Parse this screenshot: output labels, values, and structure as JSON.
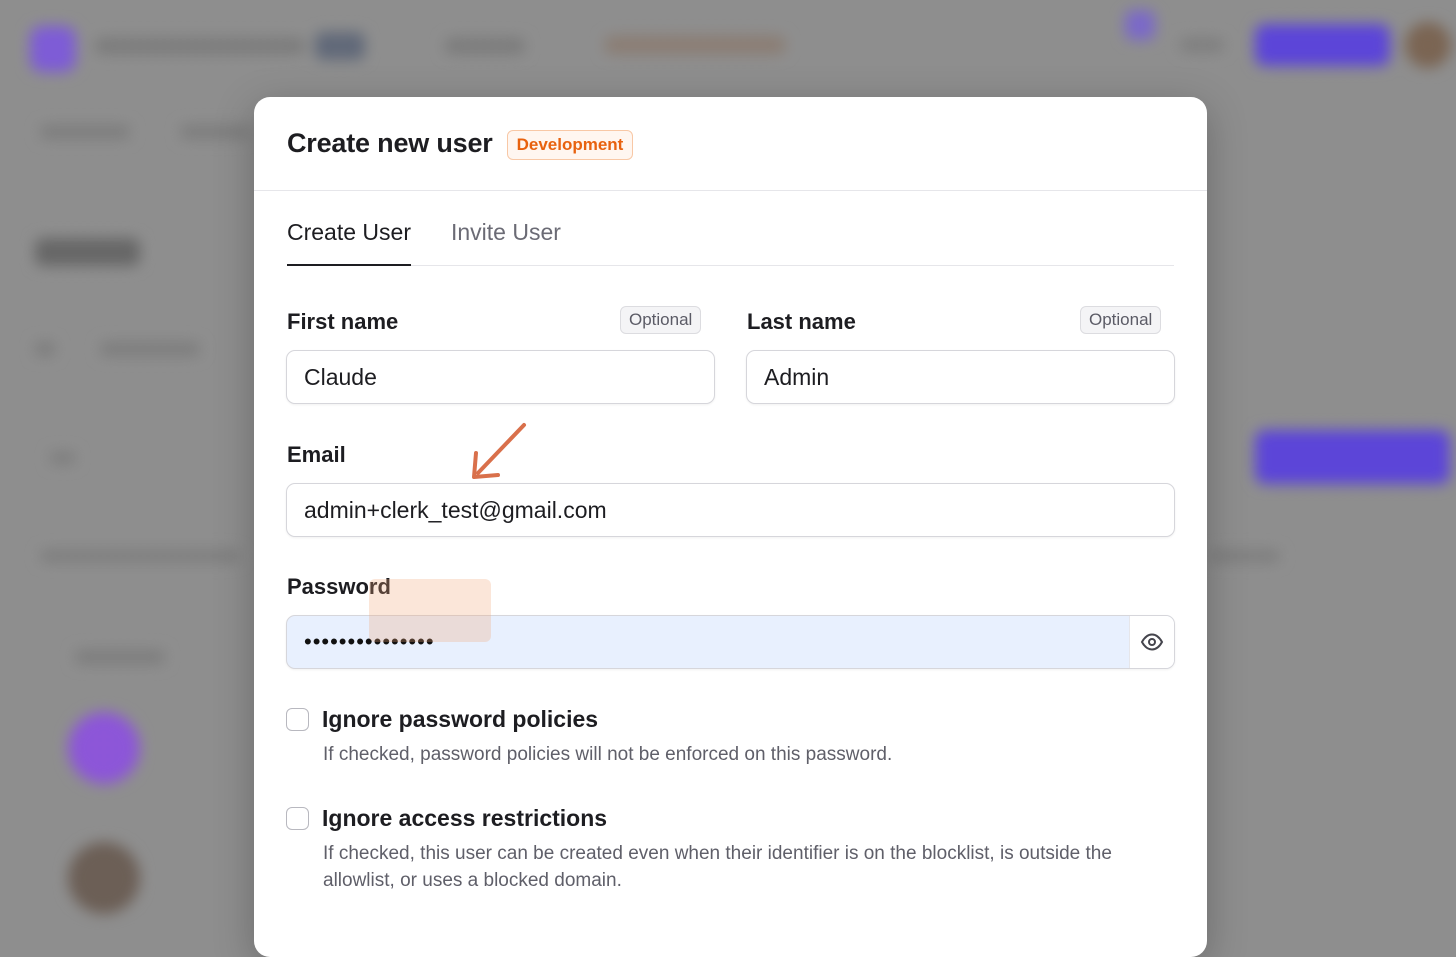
{
  "modal": {
    "title": "Create new user",
    "environment_badge": "Development"
  },
  "tabs": [
    {
      "label": "Create User",
      "active": true
    },
    {
      "label": "Invite User",
      "active": false
    }
  ],
  "form": {
    "first_name": {
      "label": "First name",
      "badge": "Optional",
      "value": "Claude"
    },
    "last_name": {
      "label": "Last name",
      "badge": "Optional",
      "value": "Admin"
    },
    "email": {
      "label": "Email",
      "value": "admin+clerk_test@gmail.com",
      "highlighted_part": "+clerk_test"
    },
    "password": {
      "label": "Password",
      "masked_value": "•••••••••••••••",
      "reveal_icon": "eye-icon"
    },
    "options": [
      {
        "label": "Ignore password policies",
        "checked": false,
        "help": "If checked, password policies will not be enforced on this password."
      },
      {
        "label": "Ignore access restrictions",
        "checked": false,
        "help": "If checked, this user can be created even when their identifier is on the blocklist, is outside the allowlist, or uses a blocked domain."
      }
    ]
  },
  "colors": {
    "accent_orange": "#e8620f",
    "annotation_arrow": "#d9704b",
    "backdrop_purple": "#6c47ff"
  }
}
